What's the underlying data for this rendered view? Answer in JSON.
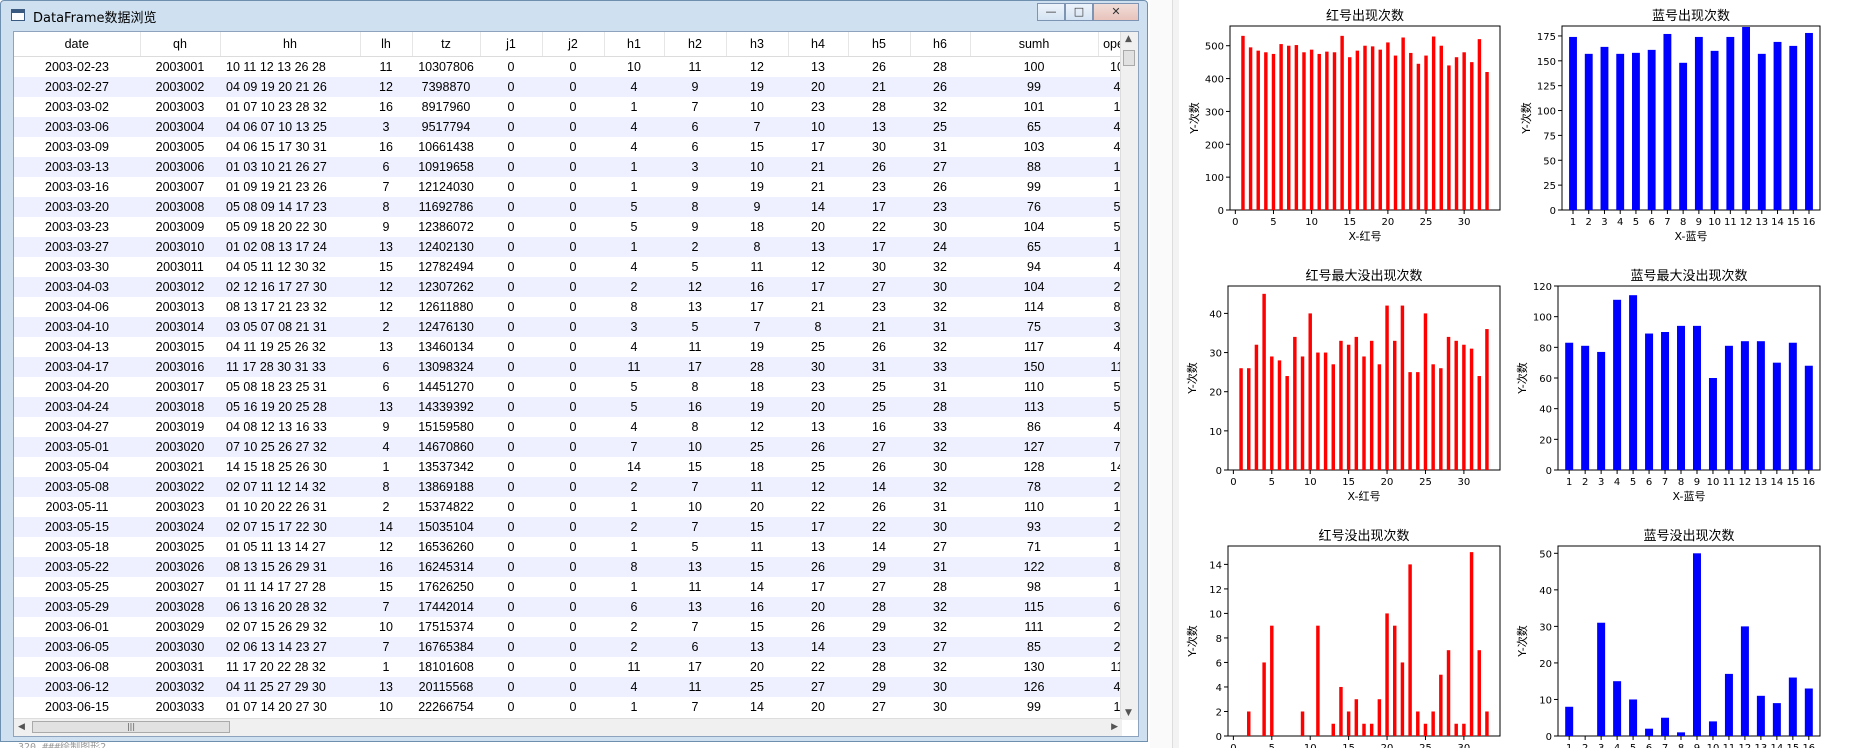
{
  "window": {
    "title": "DataFrame数据浏览",
    "min_label": "—",
    "max_label": "□",
    "close_label": "✕"
  },
  "table": {
    "columns": [
      "date",
      "qh",
      "hh",
      "lh",
      "tz",
      "j1",
      "j2",
      "h1",
      "h2",
      "h3",
      "h4",
      "h5",
      "h6",
      "sumh",
      "open"
    ],
    "rows": [
      [
        "2003-02-23",
        "2003001",
        "10 11 12 13 26 28",
        "11",
        "10307806",
        "0",
        "0",
        "10",
        "11",
        "12",
        "13",
        "26",
        "28",
        "100",
        "10"
      ],
      [
        "2003-02-27",
        "2003002",
        "04 09 19 20 21 26",
        "12",
        "7398870",
        "0",
        "0",
        "4",
        "9",
        "19",
        "20",
        "21",
        "26",
        "99",
        "4"
      ],
      [
        "2003-03-02",
        "2003003",
        "01 07 10 23 28 32",
        "16",
        "8917960",
        "0",
        "0",
        "1",
        "7",
        "10",
        "23",
        "28",
        "32",
        "101",
        "1"
      ],
      [
        "2003-03-06",
        "2003004",
        "04 06 07 10 13 25",
        "3",
        "9517794",
        "0",
        "0",
        "4",
        "6",
        "7",
        "10",
        "13",
        "25",
        "65",
        "4"
      ],
      [
        "2003-03-09",
        "2003005",
        "04 06 15 17 30 31",
        "16",
        "10661438",
        "0",
        "0",
        "4",
        "6",
        "15",
        "17",
        "30",
        "31",
        "103",
        "4"
      ],
      [
        "2003-03-13",
        "2003006",
        "01 03 10 21 26 27",
        "6",
        "10919658",
        "0",
        "0",
        "1",
        "3",
        "10",
        "21",
        "26",
        "27",
        "88",
        "1"
      ],
      [
        "2003-03-16",
        "2003007",
        "01 09 19 21 23 26",
        "7",
        "12124030",
        "0",
        "0",
        "1",
        "9",
        "19",
        "21",
        "23",
        "26",
        "99",
        "1"
      ],
      [
        "2003-03-20",
        "2003008",
        "05 08 09 14 17 23",
        "8",
        "11692786",
        "0",
        "0",
        "5",
        "8",
        "9",
        "14",
        "17",
        "23",
        "76",
        "5"
      ],
      [
        "2003-03-23",
        "2003009",
        "05 09 18 20 22 30",
        "9",
        "12386072",
        "0",
        "0",
        "5",
        "9",
        "18",
        "20",
        "22",
        "30",
        "104",
        "5"
      ],
      [
        "2003-03-27",
        "2003010",
        "01 02 08 13 17 24",
        "13",
        "12402130",
        "0",
        "0",
        "1",
        "2",
        "8",
        "13",
        "17",
        "24",
        "65",
        "1"
      ],
      [
        "2003-03-30",
        "2003011",
        "04 05 11 12 30 32",
        "15",
        "12782494",
        "0",
        "0",
        "4",
        "5",
        "11",
        "12",
        "30",
        "32",
        "94",
        "4"
      ],
      [
        "2003-04-03",
        "2003012",
        "02 12 16 17 27 30",
        "12",
        "12307262",
        "0",
        "0",
        "2",
        "12",
        "16",
        "17",
        "27",
        "30",
        "104",
        "2"
      ],
      [
        "2003-04-06",
        "2003013",
        "08 13 17 21 23 32",
        "12",
        "12611880",
        "0",
        "0",
        "8",
        "13",
        "17",
        "21",
        "23",
        "32",
        "114",
        "8"
      ],
      [
        "2003-04-10",
        "2003014",
        "03 05 07 08 21 31",
        "2",
        "12476130",
        "0",
        "0",
        "3",
        "5",
        "7",
        "8",
        "21",
        "31",
        "75",
        "3"
      ],
      [
        "2003-04-13",
        "2003015",
        "04 11 19 25 26 32",
        "13",
        "13460134",
        "0",
        "0",
        "4",
        "11",
        "19",
        "25",
        "26",
        "32",
        "117",
        "4"
      ],
      [
        "2003-04-17",
        "2003016",
        "11 17 28 30 31 33",
        "6",
        "13098324",
        "0",
        "0",
        "11",
        "17",
        "28",
        "30",
        "31",
        "33",
        "150",
        "11"
      ],
      [
        "2003-04-20",
        "2003017",
        "05 08 18 23 25 31",
        "6",
        "14451270",
        "0",
        "0",
        "5",
        "8",
        "18",
        "23",
        "25",
        "31",
        "110",
        "5"
      ],
      [
        "2003-04-24",
        "2003018",
        "05 16 19 20 25 28",
        "13",
        "14339392",
        "0",
        "0",
        "5",
        "16",
        "19",
        "20",
        "25",
        "28",
        "113",
        "5"
      ],
      [
        "2003-04-27",
        "2003019",
        "04 08 12 13 16 33",
        "9",
        "15159580",
        "0",
        "0",
        "4",
        "8",
        "12",
        "13",
        "16",
        "33",
        "86",
        "4"
      ],
      [
        "2003-05-01",
        "2003020",
        "07 10 25 26 27 32",
        "4",
        "14670860",
        "0",
        "0",
        "7",
        "10",
        "25",
        "26",
        "27",
        "32",
        "127",
        "7"
      ],
      [
        "2003-05-04",
        "2003021",
        "14 15 18 25 26 30",
        "1",
        "13537342",
        "0",
        "0",
        "14",
        "15",
        "18",
        "25",
        "26",
        "30",
        "128",
        "14"
      ],
      [
        "2003-05-08",
        "2003022",
        "02 07 11 12 14 32",
        "8",
        "13869188",
        "0",
        "0",
        "2",
        "7",
        "11",
        "12",
        "14",
        "32",
        "78",
        "2"
      ],
      [
        "2003-05-11",
        "2003023",
        "01 10 20 22 26 31",
        "2",
        "15374822",
        "0",
        "0",
        "1",
        "10",
        "20",
        "22",
        "26",
        "31",
        "110",
        "1"
      ],
      [
        "2003-05-15",
        "2003024",
        "02 07 15 17 22 30",
        "14",
        "15035104",
        "0",
        "0",
        "2",
        "7",
        "15",
        "17",
        "22",
        "30",
        "93",
        "2"
      ],
      [
        "2003-05-18",
        "2003025",
        "01 05 11 13 14 27",
        "12",
        "16536260",
        "0",
        "0",
        "1",
        "5",
        "11",
        "13",
        "14",
        "27",
        "71",
        "1"
      ],
      [
        "2003-05-22",
        "2003026",
        "08 13 15 26 29 31",
        "16",
        "16245314",
        "0",
        "0",
        "8",
        "13",
        "15",
        "26",
        "29",
        "31",
        "122",
        "8"
      ],
      [
        "2003-05-25",
        "2003027",
        "01 11 14 17 27 28",
        "15",
        "17626250",
        "0",
        "0",
        "1",
        "11",
        "14",
        "17",
        "27",
        "28",
        "98",
        "1"
      ],
      [
        "2003-05-29",
        "2003028",
        "06 13 16 20 28 32",
        "7",
        "17442014",
        "0",
        "0",
        "6",
        "13",
        "16",
        "20",
        "28",
        "32",
        "115",
        "6"
      ],
      [
        "2003-06-01",
        "2003029",
        "02 07 15 26 29 32",
        "10",
        "17515374",
        "0",
        "0",
        "2",
        "7",
        "15",
        "26",
        "29",
        "32",
        "111",
        "2"
      ],
      [
        "2003-06-05",
        "2003030",
        "02 06 13 14 23 27",
        "7",
        "16765384",
        "0",
        "0",
        "2",
        "6",
        "13",
        "14",
        "23",
        "27",
        "85",
        "2"
      ],
      [
        "2003-06-08",
        "2003031",
        "11 17 20 22 28 32",
        "1",
        "18101608",
        "0",
        "0",
        "11",
        "17",
        "20",
        "22",
        "28",
        "32",
        "130",
        "11"
      ],
      [
        "2003-06-12",
        "2003032",
        "04 11 25 27 29 30",
        "13",
        "20115568",
        "0",
        "0",
        "4",
        "11",
        "25",
        "27",
        "29",
        "30",
        "126",
        "4"
      ],
      [
        "2003-06-15",
        "2003033",
        "01 07 14 20 27 30",
        "10",
        "22266754",
        "0",
        "0",
        "1",
        "7",
        "14",
        "20",
        "27",
        "30",
        "99",
        "1"
      ]
    ]
  },
  "below_text": "320 ###绘制图形2",
  "colors": {
    "red": "#ff0000",
    "blue": "#0000ff"
  },
  "chart_data": [
    {
      "type": "bar",
      "title": "红号出现次数",
      "xlabel": "X-红号",
      "ylabel": "Y-次数",
      "color": "red",
      "ylim": [
        0,
        560
      ],
      "yticks": [
        0,
        100,
        200,
        300,
        400,
        500
      ],
      "xticks": [
        0,
        5,
        10,
        15,
        20,
        25,
        30
      ],
      "x": [
        1,
        2,
        3,
        4,
        5,
        6,
        7,
        8,
        9,
        10,
        11,
        12,
        13,
        14,
        15,
        16,
        17,
        18,
        19,
        20,
        21,
        22,
        23,
        24,
        25,
        26,
        27,
        28,
        29,
        30,
        31,
        32,
        33
      ],
      "values": [
        530,
        495,
        485,
        480,
        475,
        505,
        500,
        502,
        480,
        488,
        475,
        482,
        480,
        530,
        465,
        485,
        500,
        498,
        488,
        510,
        470,
        525,
        478,
        445,
        470,
        528,
        500,
        440,
        465,
        480,
        450,
        520,
        420
      ]
    },
    {
      "type": "bar",
      "title": "蓝号出现次数",
      "xlabel": "X-蓝号",
      "ylabel": "Y-次数",
      "color": "blue",
      "ylim": [
        0,
        185
      ],
      "yticks": [
        0,
        25,
        50,
        75,
        100,
        125,
        150,
        175
      ],
      "xticks": [
        1,
        2,
        3,
        4,
        5,
        6,
        7,
        8,
        9,
        10,
        11,
        12,
        13,
        14,
        15,
        16
      ],
      "x": [
        1,
        2,
        3,
        4,
        5,
        6,
        7,
        8,
        9,
        10,
        11,
        12,
        13,
        14,
        15,
        16
      ],
      "values": [
        174,
        157,
        164,
        157,
        158,
        161,
        177,
        148,
        174,
        160,
        174,
        184,
        157,
        169,
        165,
        178
      ]
    },
    {
      "type": "bar",
      "title": "红号最大没出现次数",
      "xlabel": "X-红号",
      "ylabel": "Y-次数",
      "color": "red",
      "ylim": [
        0,
        47
      ],
      "yticks": [
        0,
        10,
        20,
        30,
        40
      ],
      "xticks": [
        0,
        5,
        10,
        15,
        20,
        25,
        30
      ],
      "x": [
        1,
        2,
        3,
        4,
        5,
        6,
        7,
        8,
        9,
        10,
        11,
        12,
        13,
        14,
        15,
        16,
        17,
        18,
        19,
        20,
        21,
        22,
        23,
        24,
        25,
        26,
        27,
        28,
        29,
        30,
        31,
        32,
        33
      ],
      "values": [
        26,
        26,
        32,
        45,
        29,
        28,
        24,
        34,
        29,
        40,
        30,
        30,
        27,
        33,
        32,
        34,
        29,
        33,
        27,
        42,
        33,
        42,
        25,
        25,
        40,
        27,
        26,
        34,
        33,
        32,
        31,
        24,
        36
      ]
    },
    {
      "type": "bar",
      "title": "蓝号最大没出现次数",
      "xlabel": "X-蓝号",
      "ylabel": "Y-次数",
      "color": "blue",
      "ylim": [
        0,
        120
      ],
      "yticks": [
        0,
        20,
        40,
        60,
        80,
        100,
        120
      ],
      "xticks": [
        1,
        2,
        3,
        4,
        5,
        6,
        7,
        8,
        9,
        10,
        11,
        12,
        13,
        14,
        15,
        16
      ],
      "x": [
        1,
        2,
        3,
        4,
        5,
        6,
        7,
        8,
        9,
        10,
        11,
        12,
        13,
        14,
        15,
        16
      ],
      "values": [
        83,
        81,
        77,
        111,
        114,
        89,
        90,
        94,
        94,
        60,
        81,
        84,
        84,
        70,
        83,
        68
      ]
    },
    {
      "type": "bar",
      "title": "红号没出现次数",
      "xlabel": "X-红号",
      "ylabel": "Y-次数",
      "color": "red",
      "ylim": [
        0,
        15.5
      ],
      "yticks": [
        0,
        2,
        4,
        6,
        8,
        10,
        12,
        14
      ],
      "xticks": [
        0,
        5,
        10,
        15,
        20,
        25,
        30
      ],
      "x": [
        1,
        2,
        3,
        4,
        5,
        6,
        7,
        8,
        9,
        10,
        11,
        12,
        13,
        14,
        15,
        16,
        17,
        18,
        19,
        20,
        21,
        22,
        23,
        24,
        25,
        26,
        27,
        28,
        29,
        30,
        31,
        32,
        33
      ],
      "values": [
        0,
        2,
        0,
        6,
        9,
        0,
        0,
        0,
        2,
        0,
        9,
        0,
        1,
        4,
        2,
        3,
        1,
        1,
        3,
        10,
        9,
        6,
        14,
        2,
        1,
        2,
        5,
        7,
        1,
        1,
        15,
        7,
        2,
        3
      ]
    },
    {
      "type": "bar",
      "title": "蓝号没出现次数",
      "xlabel": "X-蓝号",
      "ylabel": "Y-次数",
      "color": "blue",
      "ylim": [
        0,
        52
      ],
      "yticks": [
        0,
        10,
        20,
        30,
        40,
        50
      ],
      "xticks": [
        1,
        2,
        3,
        4,
        5,
        6,
        7,
        8,
        9,
        10,
        11,
        12,
        13,
        14,
        15,
        16
      ],
      "x": [
        1,
        2,
        3,
        4,
        5,
        6,
        7,
        8,
        9,
        10,
        11,
        12,
        13,
        14,
        15,
        16
      ],
      "values": [
        8,
        0,
        31,
        15,
        10,
        2,
        5,
        1,
        50,
        4,
        17,
        30,
        11,
        9,
        16,
        13
      ]
    }
  ]
}
